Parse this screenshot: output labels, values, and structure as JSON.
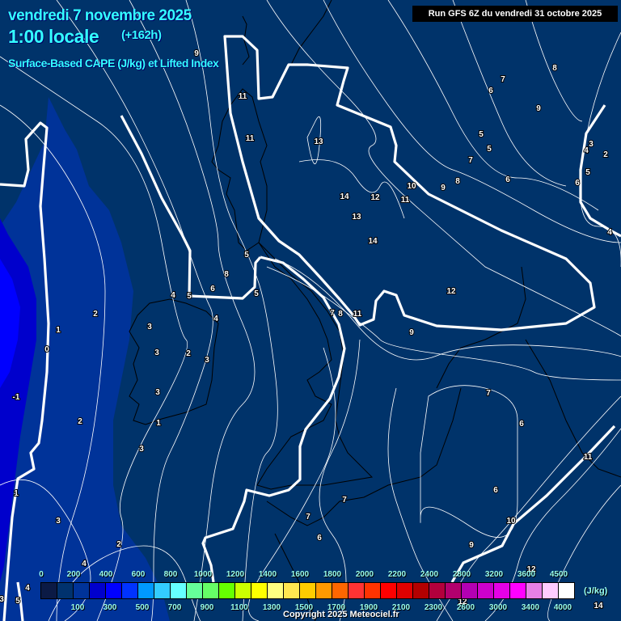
{
  "header": {
    "date": "vendredi 7 novembre 2025",
    "time": "1:00 locale",
    "lead": "(+162h)",
    "parameter": "Surface-Based CAPE (J/kg) et Lifted Index",
    "run": "Run GFS 6Z du vendredi 31 octobre 2025"
  },
  "legend": {
    "unit": "(J/kg)",
    "colors": [
      "#0b1a45",
      "#00326e",
      "#003399",
      "#0000cc",
      "#0000ff",
      "#0033ff",
      "#0099ff",
      "#33ccff",
      "#66ffff",
      "#66ff99",
      "#66ff66",
      "#66ff00",
      "#ccff00",
      "#ffff00",
      "#ffff80",
      "#ffe650",
      "#ffcc00",
      "#ff9900",
      "#ff6600",
      "#ff3333",
      "#ff3300",
      "#ff0000",
      "#e00000",
      "#b30000",
      "#b3003c",
      "#b3006e",
      "#b300b3",
      "#cc00cc",
      "#e600e6",
      "#ff00ff",
      "#e680e6",
      "#ffccff",
      "#ffffff"
    ],
    "top_labels": [
      "0",
      "200",
      "400",
      "600",
      "800",
      "1000",
      "1200",
      "1400",
      "1600",
      "1800",
      "2000",
      "2200",
      "2400",
      "2800",
      "3200",
      "3600",
      "4500"
    ],
    "bottom_labels": [
      "100",
      "300",
      "500",
      "700",
      "900",
      "1100",
      "1300",
      "1500",
      "1700",
      "1900",
      "2100",
      "2300",
      "2600",
      "3000",
      "3400",
      "4000"
    ]
  },
  "copyright": "Copyright 2025 Meteociel.fr",
  "map": {
    "background_color": "#00336a",
    "lifted_index_labels": [
      "9",
      "8",
      "7",
      "6",
      "9",
      "11",
      "11",
      "13",
      "5",
      "5",
      "4",
      "3",
      "2",
      "7",
      "5",
      "6",
      "6",
      "8",
      "9",
      "10",
      "14",
      "12",
      "11",
      "13",
      "14",
      "4",
      "5",
      "8",
      "6",
      "5",
      "4",
      "5",
      "12",
      "7",
      "8",
      "11",
      "2",
      "4",
      "3",
      "1",
      "9",
      "0",
      "3",
      "2",
      "3",
      "-1",
      "3",
      "7",
      "2",
      "1",
      "6",
      "3",
      "11",
      "1",
      "6",
      "7",
      "3",
      "10",
      "7",
      "6",
      "2",
      "9",
      "4",
      "12",
      "4",
      "3",
      "5",
      "12",
      "14"
    ]
  }
}
